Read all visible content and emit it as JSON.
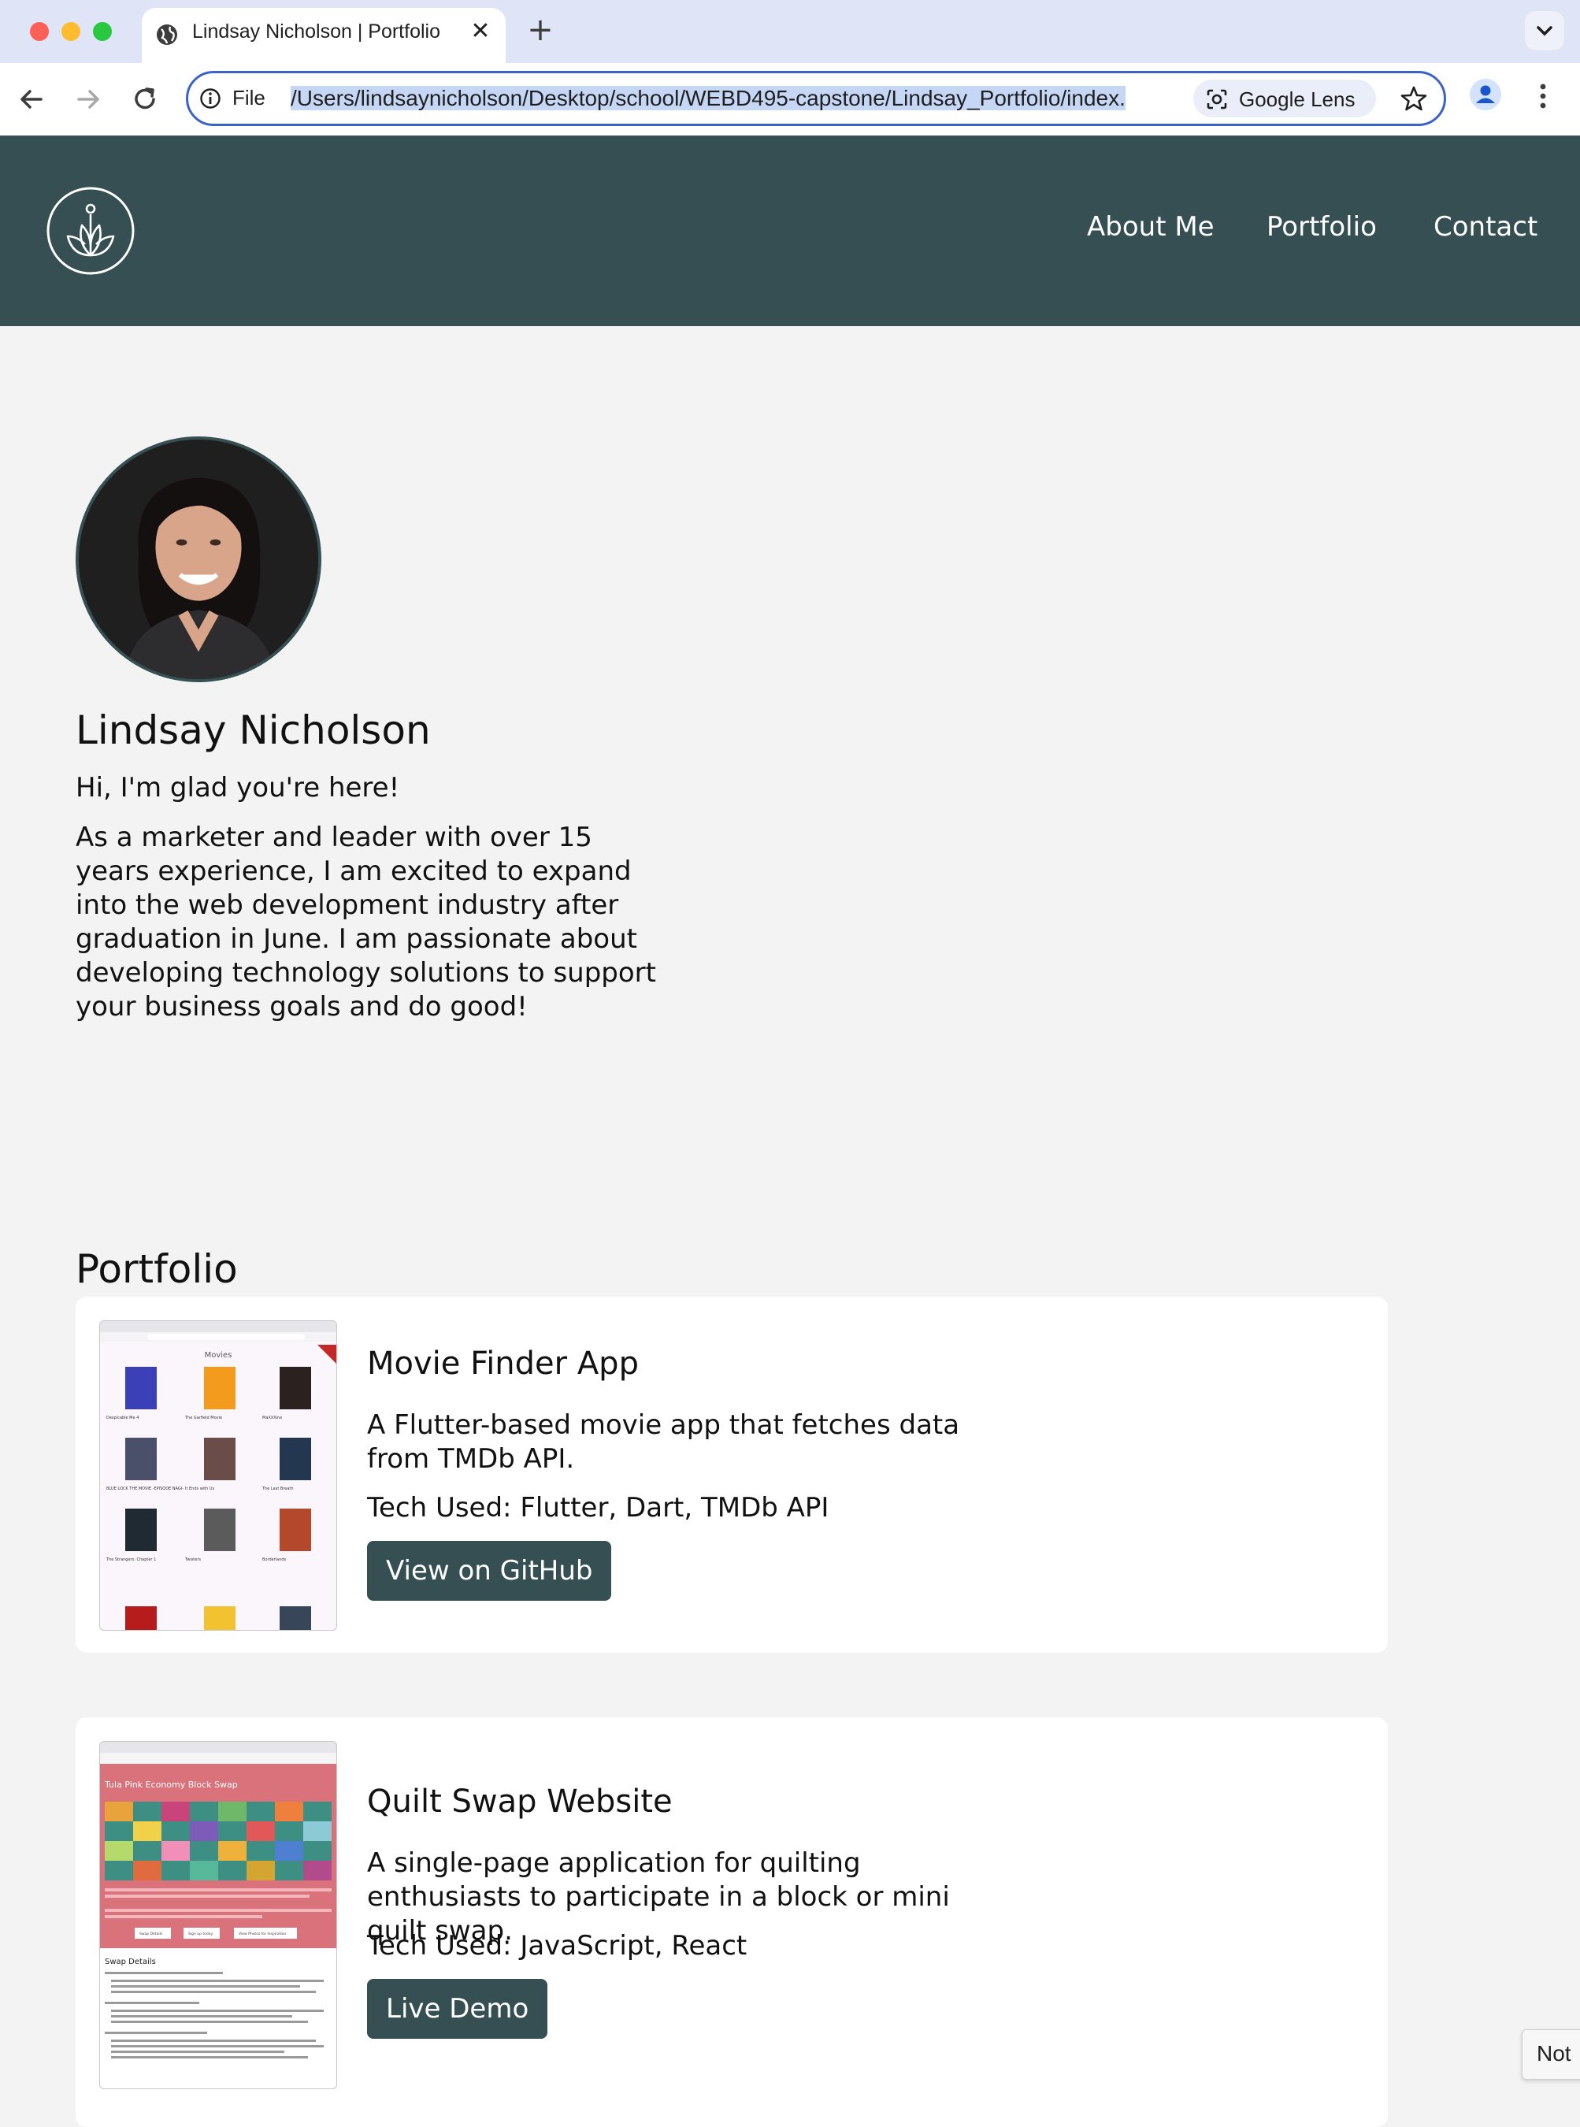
{
  "browser": {
    "tab_title": "Lindsay Nicholson | Portfolio",
    "tab_close": "✕",
    "new_tab": "+",
    "scheme_label": "File",
    "url": "/Users/lindsaynicholson/Desktop/school/WEBD495-capstone/Lindsay_Portfolio/index.",
    "lens_label": "Google Lens"
  },
  "header": {
    "nav": [
      "About Me",
      "Portfolio",
      "Contact"
    ],
    "background": "#354f52"
  },
  "hero": {
    "name": "Lindsay Nicholson",
    "greeting": "Hi, I'm glad you're here!",
    "bio": "As a marketer and leader with over 15 years experience, I am excited to expand into the web development industry after graduation in June. I am passionate about developing technology solutions to support your business goals and do good!"
  },
  "portfolio": {
    "heading": "Portfolio",
    "projects": [
      {
        "title": "Movie Finder App",
        "description": "A Flutter-based movie app that fetches data from TMDb API.",
        "tech": "Tech Used: Flutter, Dart, TMDb API",
        "button": "View on GitHub",
        "thumbnail": {
          "header": "Movies",
          "movies": [
            "Despicable Me 4",
            "The Garfield Movie",
            "MaXXXine",
            "BLUE LOCK THE MOVIE -EPISODE NAGI-",
            "It Ends with Us",
            "The Last Breath",
            "The Strangers: Chapter 1",
            "Twisters",
            "Borderlands"
          ]
        }
      },
      {
        "title": "Quilt Swap Website",
        "description": "A single-page application for quilting enthusiasts to participate in a block or mini quilt swap.",
        "tech": "Tech Used: JavaScript, React",
        "button": "Live Demo",
        "thumbnail": {
          "banner": "Tula Pink Economy Block Swap",
          "buttons": [
            "Swap Details",
            "Sign up today",
            "View Photos for Inspiration"
          ],
          "section": "Swap Details"
        }
      }
    ]
  },
  "overlay": {
    "corner_text": "Not"
  },
  "colors": {
    "accent": "#354f52",
    "page_bg": "#f3f3f3",
    "omnibox_border": "#3a62c8"
  }
}
